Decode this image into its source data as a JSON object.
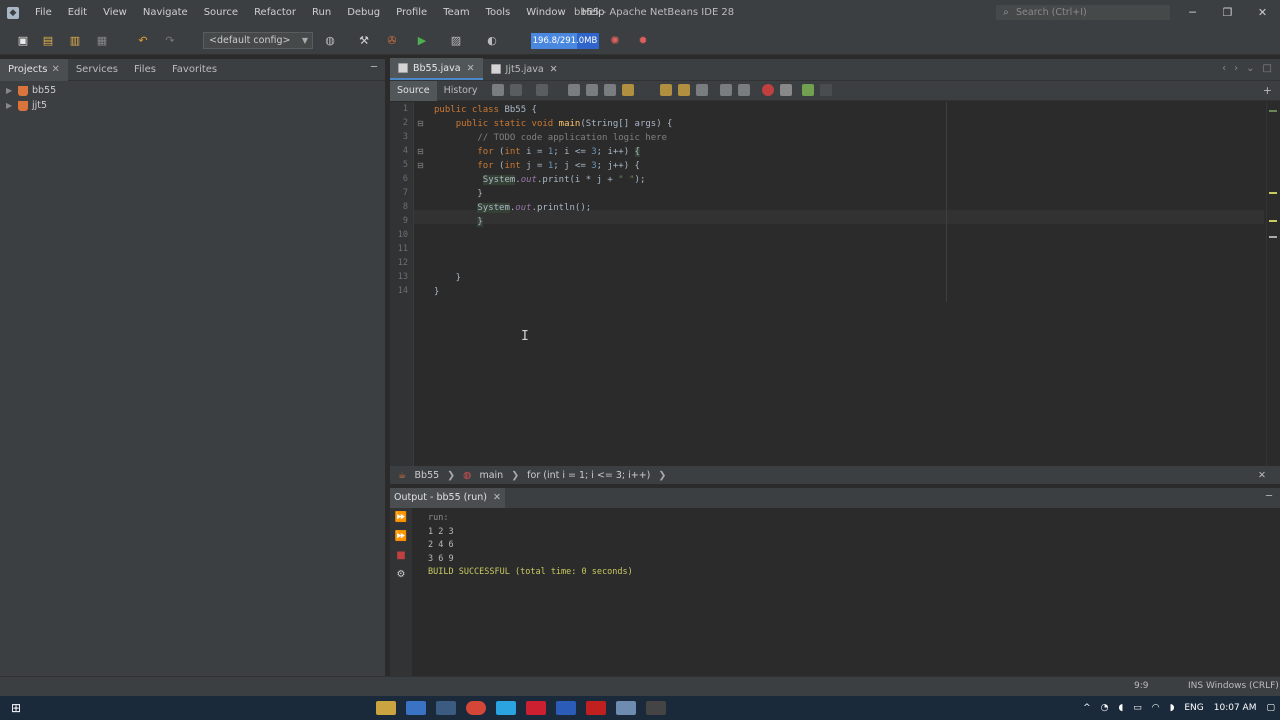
{
  "app": {
    "window_title": "bb55 - Apache NetBeans IDE 28",
    "menu": [
      "File",
      "Edit",
      "View",
      "Navigate",
      "Source",
      "Refactor",
      "Run",
      "Debug",
      "Profile",
      "Team",
      "Tools",
      "Window",
      "Help"
    ],
    "search_placeholder": "Search (Ctrl+I)"
  },
  "toolbar": {
    "config": "<default config>",
    "memory": "196.8/291.0MB",
    "memory_fraction": 0.68
  },
  "projects_panel": {
    "tabs": [
      "Projects",
      "Services",
      "Files",
      "Favorites"
    ],
    "items": [
      "bb55",
      "jjt5"
    ]
  },
  "editor": {
    "tabs": [
      "Bb55.java",
      "Jjt5.java"
    ],
    "source_tab": "Source",
    "history_tab": "History",
    "line_numbers": [
      "1",
      "2",
      "3",
      "4",
      "5",
      "6",
      "7",
      "8",
      "9",
      "10",
      "11",
      "12",
      "13",
      "14"
    ]
  },
  "breadcrumbs": [
    "Bb55",
    "main",
    "for (int i = 1; i <= 3; i++)"
  ],
  "output": {
    "title": "Output - bb55 (run)",
    "lines": [
      "run:",
      "1 2 3",
      "2 4 6",
      "3 6 9",
      "BUILD SUCCESSFUL (total time: 0 seconds)"
    ]
  },
  "status": {
    "position": "9:9",
    "insert_mode": "INS",
    "line_ending": "Windows (CRLF)"
  },
  "taskbar": {
    "language": "ENG",
    "time": "10:07 AM"
  }
}
